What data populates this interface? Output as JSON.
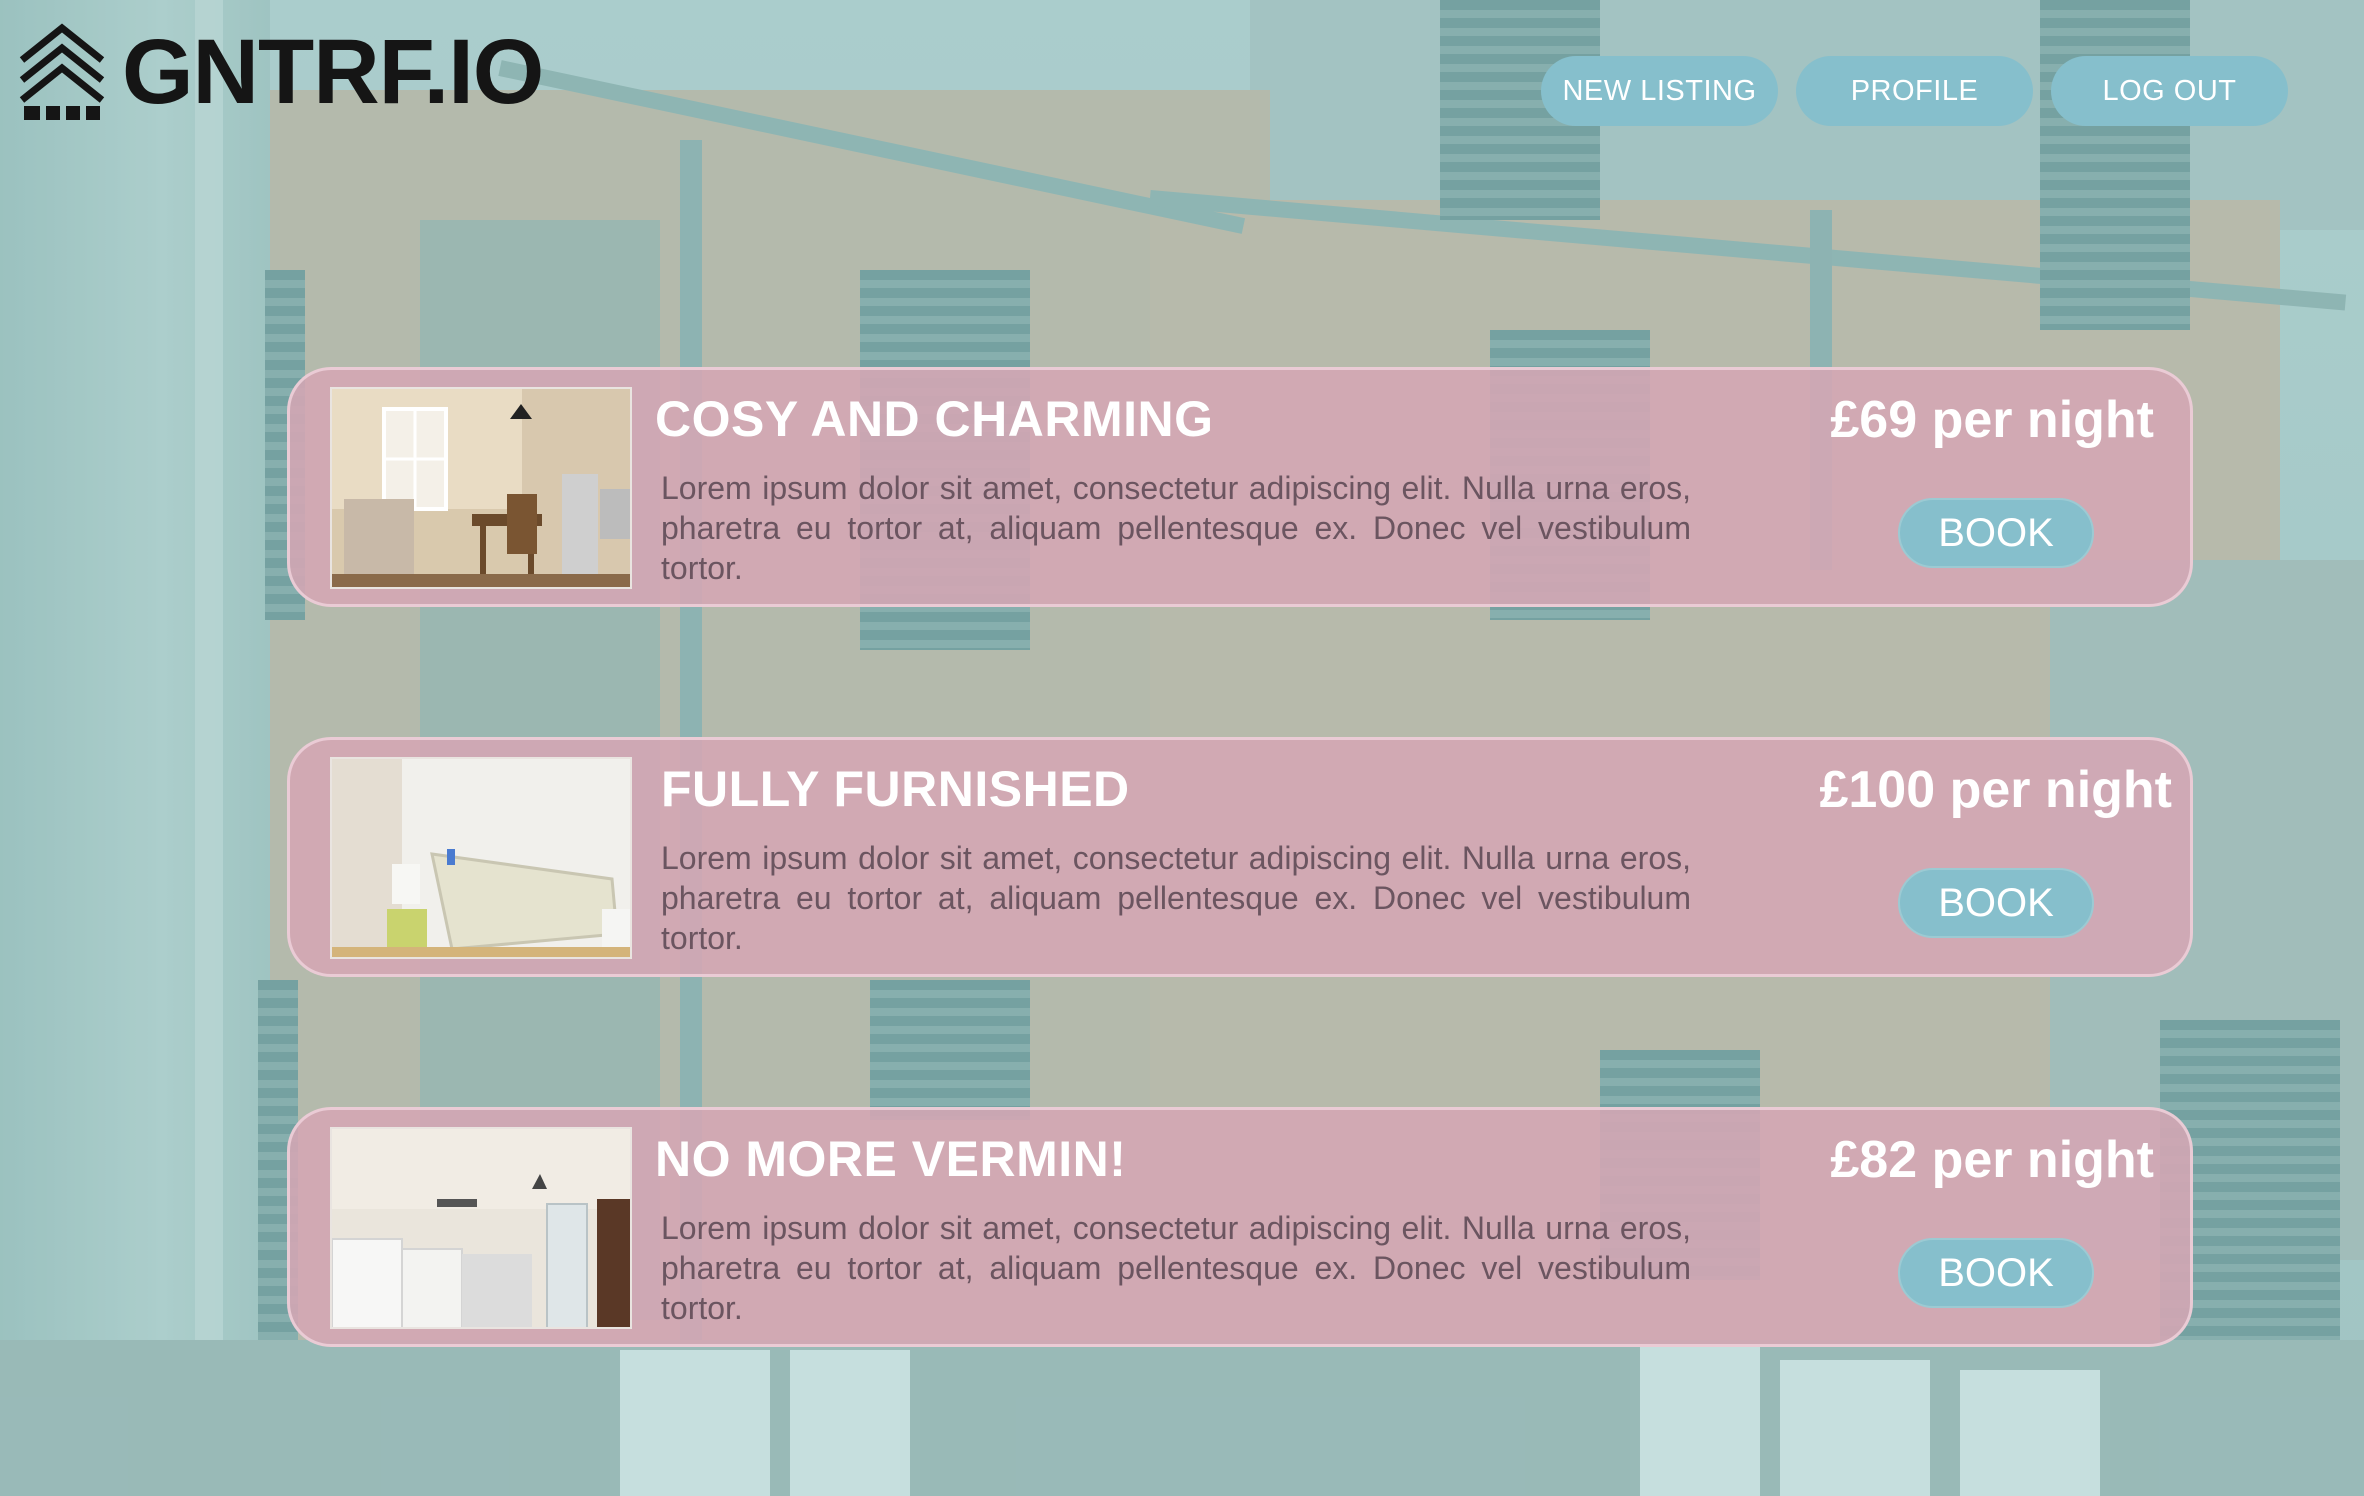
{
  "brand": {
    "name": "GNTRF.IO",
    "icon": "house-pine-logo-icon"
  },
  "nav": {
    "new_listing": "NEW LISTING",
    "profile": "PROFILE",
    "log_out": "LOG OUT"
  },
  "colors": {
    "button": "#86bfcc",
    "card": "#d5a6b4",
    "text_light": "#ffffff",
    "logo": "#151515"
  },
  "listings": [
    {
      "title": "COSY AND CHARMING",
      "description": "Lorem ipsum dolor sit amet, consectetur adipiscing elit. Nulla urna eros, pharetra eu tortor at, aliquam pellentesque ex. Donec vel vestibulum tortor.",
      "price": "£69 per night",
      "book_label": "BOOK",
      "photo": "living-room-photo"
    },
    {
      "title": "FULLY FURNISHED",
      "description": "Lorem ipsum dolor sit amet, consectetur adipiscing elit. Nulla urna eros, pharetra eu tortor at, aliquam pellentesque ex. Donec vel vestibulum tortor.",
      "price": "£100 per night",
      "book_label": "BOOK",
      "photo": "bathroom-photo"
    },
    {
      "title": "NO MORE VERMIN!",
      "description": "Lorem ipsum dolor sit amet, consectetur adipiscing elit. Nulla urna eros, pharetra eu tortor at, aliquam pellentesque ex. Donec vel vestibulum tortor.",
      "price": "£82 per night",
      "book_label": "BOOK",
      "photo": "kitchen-photo"
    }
  ]
}
